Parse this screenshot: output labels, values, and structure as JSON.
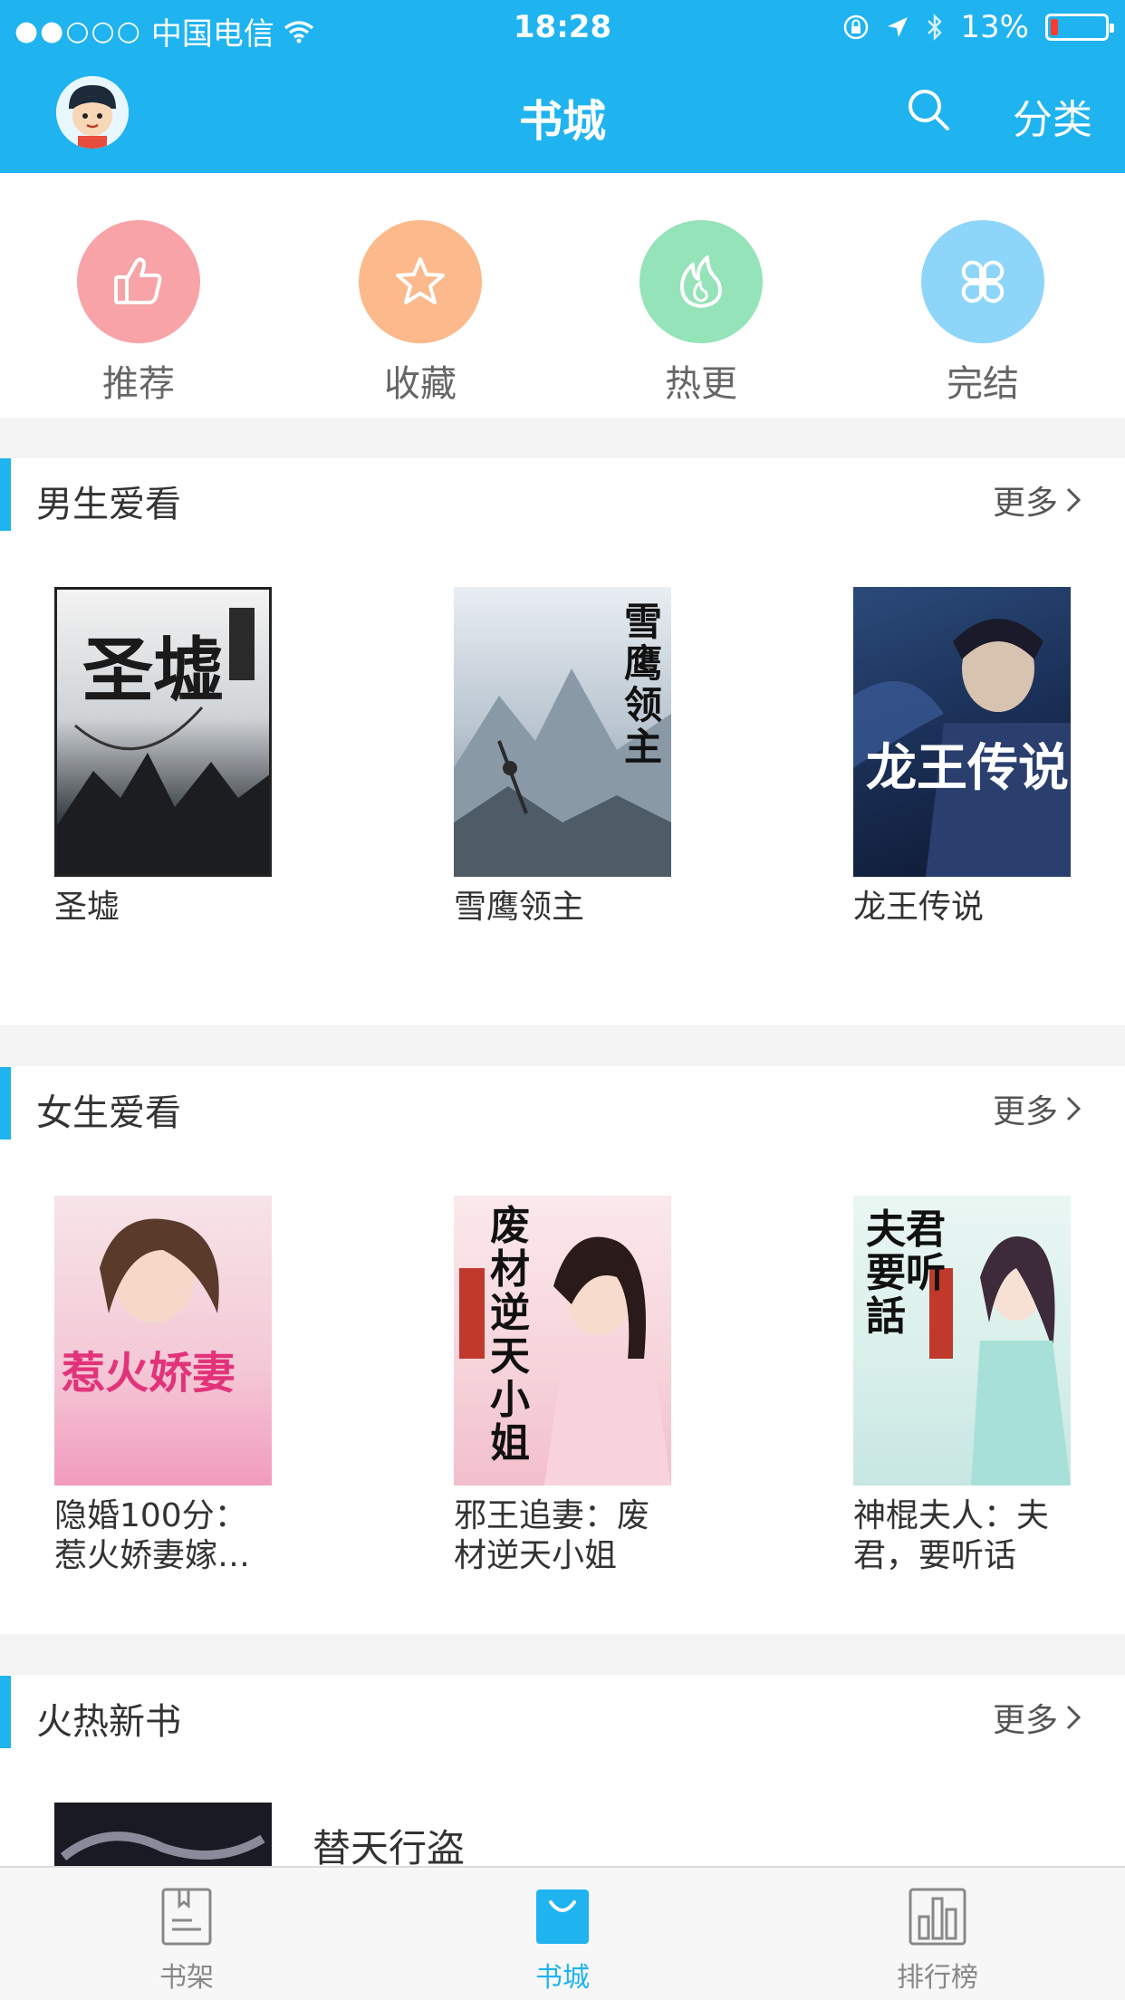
{
  "status_bar": {
    "carrier": "中国电信",
    "signal_dots": "●●○○○",
    "time": "18:28",
    "battery_percent": "13%",
    "battery_level": 0.13
  },
  "header": {
    "title": "书城",
    "category_label": "分类"
  },
  "quick_nav": [
    {
      "label": "推荐",
      "icon": "thumbs-up-icon",
      "color": "#f7a3a8"
    },
    {
      "label": "收藏",
      "icon": "star-icon",
      "color": "#fbb98c"
    },
    {
      "label": "热更",
      "icon": "flame-icon",
      "color": "#95e3b8"
    },
    {
      "label": "完结",
      "icon": "clover-icon",
      "color": "#8ed5fa"
    }
  ],
  "sections": [
    {
      "title": "男生爱看",
      "more_label": "更多",
      "books": [
        {
          "title": "圣墟",
          "cover_text": "圣墟"
        },
        {
          "title": "雪鹰领主",
          "cover_text": "雪鹰领主"
        },
        {
          "title": "龙王传说",
          "cover_text": "龙王传说"
        }
      ]
    },
    {
      "title": "女生爱看",
      "more_label": "更多",
      "books": [
        {
          "title": "隐婚100分：惹火娇妻嫁…",
          "cover_text": "惹火娇妻"
        },
        {
          "title": "邪王追妻：废材逆天小姐",
          "cover_text": "废材逆天小姐"
        },
        {
          "title": "神棍夫人：夫君，要听话",
          "cover_text": "夫君要听話"
        }
      ]
    },
    {
      "title": "火热新书",
      "more_label": "更多",
      "books": [
        {
          "title": "替天行盗"
        }
      ]
    }
  ],
  "tabbar": [
    {
      "label": "书架",
      "icon": "bookshelf-icon",
      "active": false
    },
    {
      "label": "书城",
      "icon": "bookstore-bag-icon",
      "active": true
    },
    {
      "label": "排行榜",
      "icon": "ranking-chart-icon",
      "active": false
    }
  ],
  "colors": {
    "brand": "#1fb3f0",
    "separator": "#f4f4f4"
  }
}
